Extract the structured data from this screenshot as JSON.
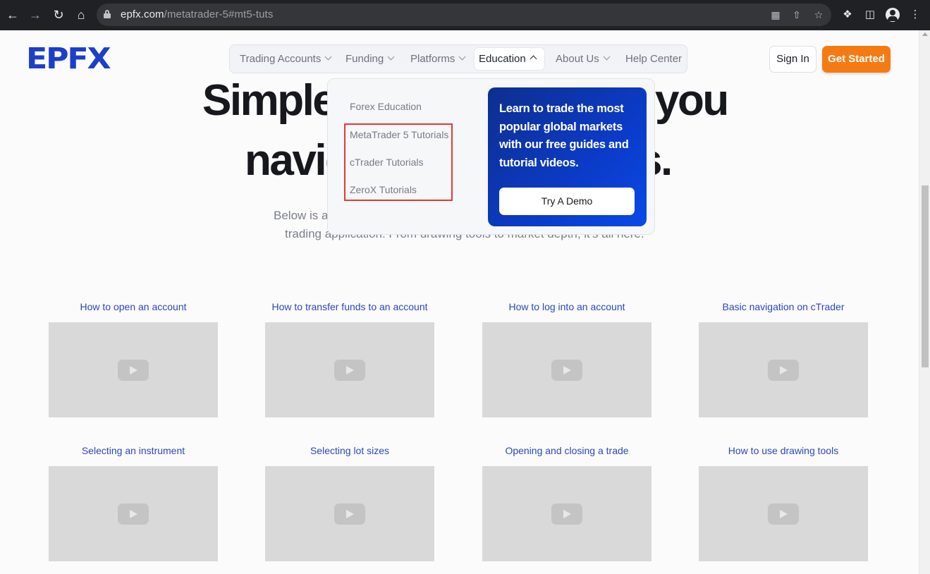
{
  "browser": {
    "url_domain": "epfx.com",
    "url_path": "/metatrader-5#mt5-tuts"
  },
  "header": {
    "logo_text": "EPFX",
    "nav": [
      {
        "label": "Trading Accounts"
      },
      {
        "label": "Funding"
      },
      {
        "label": "Platforms"
      },
      {
        "label": "Education"
      },
      {
        "label": "About Us"
      },
      {
        "label": "Help Center"
      }
    ],
    "signin_label": "Sign In",
    "getstarted_label": "Get Started"
  },
  "hero": {
    "line1_left": "Simple",
    "line1_right": "you",
    "line2_left": "navig",
    "line2_right": "s.",
    "sub1_left": "Below is a",
    "sub2": "trading application. From drawing tools to market depth, it's all here."
  },
  "dropdown": {
    "links": [
      {
        "label": "Forex Education"
      },
      {
        "label": "MetaTrader 5 Tutorials"
      },
      {
        "label": "cTrader Tutorials"
      },
      {
        "label": "ZeroX Tutorials"
      }
    ],
    "promo_text": "Learn to trade the most popular global markets with our free guides and tutorial videos.",
    "demo_label": "Try A Demo"
  },
  "videos": [
    {
      "title": "How to open an account"
    },
    {
      "title": "How to transfer funds to an account"
    },
    {
      "title": "How to log into an account"
    },
    {
      "title": "Basic navigation on cTrader"
    },
    {
      "title": "Selecting an instrument"
    },
    {
      "title": "Selecting lot sizes"
    },
    {
      "title": "Opening and closing a trade"
    },
    {
      "title": "How to use drawing tools"
    }
  ],
  "colors": {
    "brand_blue": "#1c3fc9",
    "cta_orange": "#f47b13",
    "link_blue": "#2749b8",
    "highlight_red": "#e53935"
  }
}
